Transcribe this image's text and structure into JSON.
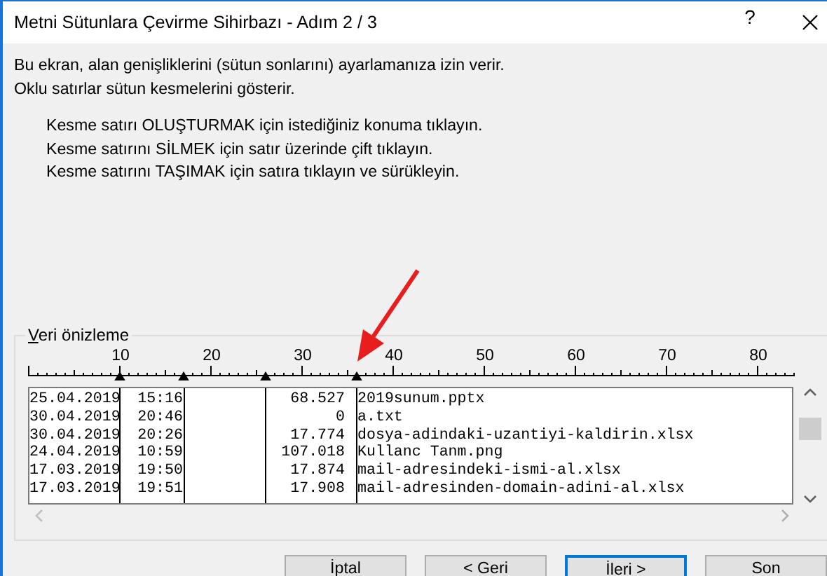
{
  "window": {
    "title": "Metni Sütunlara Çevirme Sihirbazı - Adım 2 / 3",
    "help": "?"
  },
  "description": [
    "Bu ekran, alan genişliklerini (sütun sonlarını) ayarlamanıza izin verir.",
    "Oklu satırlar sütun kesmelerini gösterir."
  ],
  "instructions": [
    "Kesme satırı OLUŞTURMAK için istediğiniz konuma tıklayın.",
    "Kesme satırını SİLMEK için satır üzerinde çift tıklayın.",
    "Kesme satırını TAŞIMAK için satıra tıklayın ve sürükleyin."
  ],
  "preview": {
    "label": "Veri önizleme",
    "ruler": [
      "10",
      "20",
      "30",
      "40",
      "50",
      "60",
      "70",
      "80"
    ],
    "rows": [
      {
        "date": "25.04.2019",
        "time": "15:16",
        "size": "68.527",
        "name": "2019sunum.pptx"
      },
      {
        "date": "30.04.2019",
        "time": "20:46",
        "size": "0",
        "name": "a.txt"
      },
      {
        "date": "30.04.2019",
        "time": "20:26",
        "size": "17.774",
        "name": "dosya-adindaki-uzantiyi-kaldirin.xlsx"
      },
      {
        "date": "24.04.2019",
        "time": "10:59",
        "size": "107.018",
        "name": "Kullanc Tanm.png"
      },
      {
        "date": "17.03.2019",
        "time": "19:50",
        "size": "17.874",
        "name": "mail-adresindeki-ismi-al.xlsx"
      },
      {
        "date": "17.03.2019",
        "time": "19:51",
        "size": "17.908",
        "name": "mail-adresinden-domain-adini-al.xlsx"
      }
    ]
  },
  "buttons": [
    {
      "label": "İptal",
      "focused": false
    },
    {
      "label": "< Geri",
      "focused": false
    },
    {
      "label": "İleri >",
      "focused": true
    },
    {
      "label": "Son",
      "focused": false
    }
  ]
}
